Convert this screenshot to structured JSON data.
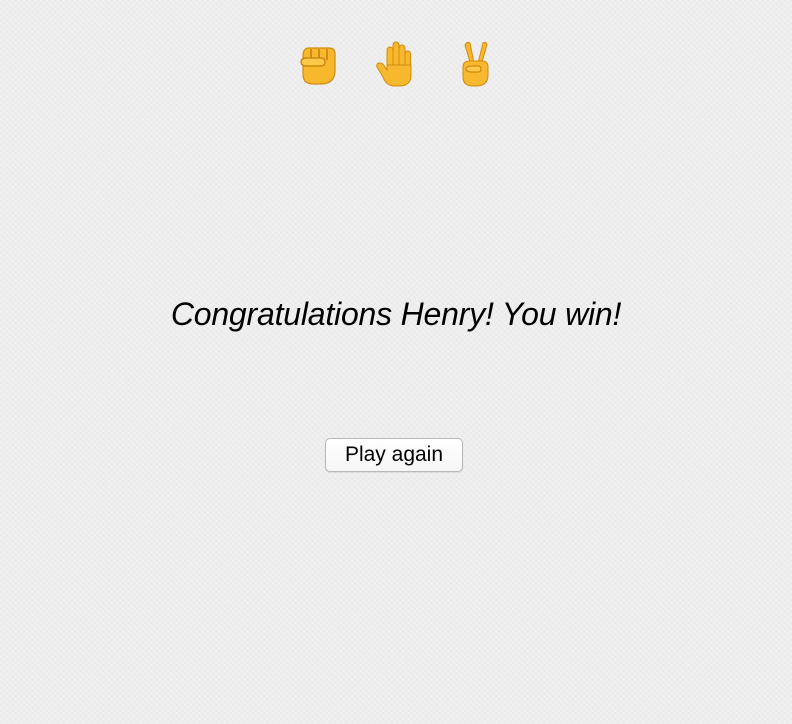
{
  "game": {
    "choices": [
      {
        "name": "rock",
        "icon": "raised-fist-icon",
        "glyph": "✊"
      },
      {
        "name": "paper",
        "icon": "raised-hand-icon",
        "glyph": "🤚"
      },
      {
        "name": "scissors",
        "icon": "victory-hand-icon",
        "glyph": "✌️"
      }
    ],
    "result_message": "Congratulations Henry! You win!",
    "play_again_label": "Play again"
  },
  "colors": {
    "background": "#ededed",
    "emoji_skin": "#f7b82e",
    "text": "#000000"
  }
}
